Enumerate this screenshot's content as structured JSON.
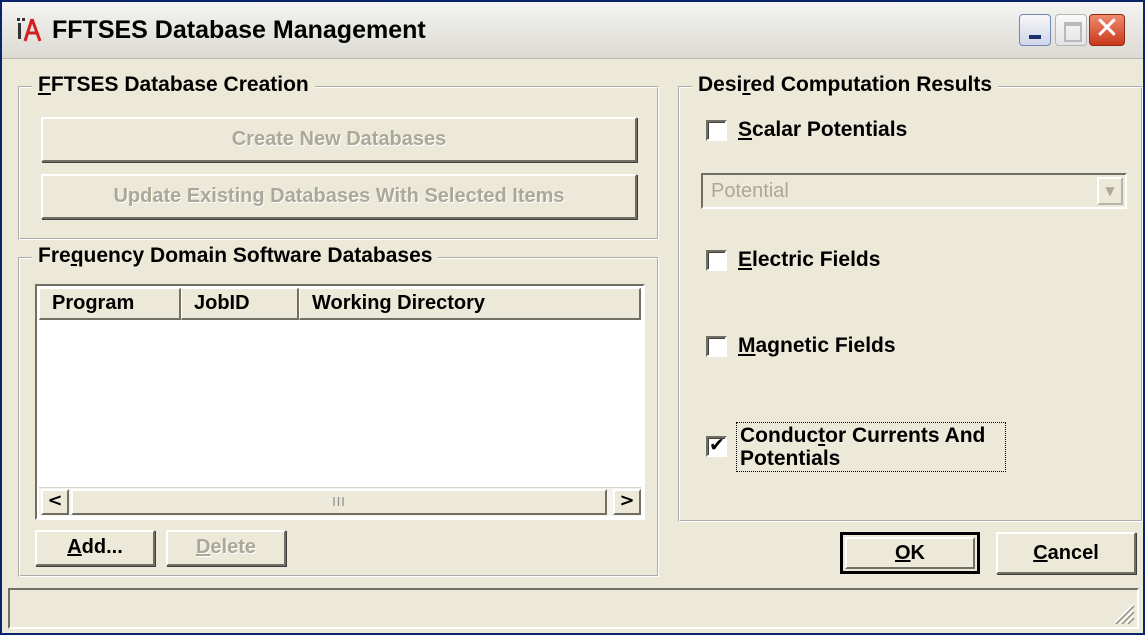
{
  "window": {
    "title": "FFTSES Database Management",
    "close_glyph": "✕"
  },
  "creation_group": {
    "label_prefix": "",
    "label_key": "F",
    "label_rest": "FTSES Database Creation",
    "create_button": "Create New Databases",
    "update_button": "Update Existing Databases With Selected Items"
  },
  "freq_group": {
    "label_prefix": "Fre",
    "label_key": "q",
    "label_rest": "uency Domain Software Databases",
    "columns": [
      "Program",
      "JobID",
      "Working Directory"
    ],
    "rows": [],
    "scroll_left": "<",
    "scroll_right": ">",
    "scroll_thumb": "III",
    "add_prefix": "",
    "add_key": "A",
    "add_rest": "dd...",
    "delete_prefix": "",
    "delete_key": "D",
    "delete_rest": "elete"
  },
  "results_group": {
    "label_prefix": "Desi",
    "label_key": "r",
    "label_rest": "ed Computation Results",
    "scalar": {
      "prefix": "",
      "key": "S",
      "rest": "calar Potentials",
      "checked": false
    },
    "combo_value": "Potential",
    "combo_arrow": "▼",
    "electric": {
      "prefix": "",
      "key": "E",
      "rest": "lectric Fields",
      "checked": false
    },
    "magnetic": {
      "prefix": "",
      "key": "M",
      "rest": "agnetic Fields",
      "checked": false
    },
    "conductor": {
      "prefix": "Conduc",
      "key": "t",
      "rest_line1": "or Currents And",
      "line2": "Potentials",
      "checked": true,
      "mark": "✔"
    }
  },
  "footer": {
    "ok_key": "O",
    "ok_rest": "K",
    "cancel_key": "C",
    "cancel_rest": "ancel"
  },
  "colors": {
    "face": "#ece9d8",
    "shadow": "#716f64",
    "disabled_text": "#aca899",
    "close_red": "#c9381b"
  }
}
